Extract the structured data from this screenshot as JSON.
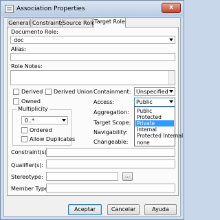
{
  "window": {
    "title": "Association Properties",
    "close_label": "x"
  },
  "tabs": [
    {
      "label": "General"
    },
    {
      "label": "Constraints"
    },
    {
      "label": "Source Role"
    },
    {
      "label": "Target Role"
    }
  ],
  "target_role": {
    "role_label": "Documento Role:",
    "role_value": "doc",
    "alias_label": "Alias:",
    "alias_value": "",
    "role_notes_label": "Role Notes:",
    "derived_label": "Derived",
    "derived_union_label": "Derived Union",
    "owned_label": "Owned",
    "multiplicity_label": "Multiplicity",
    "multiplicity_value": "0..*",
    "ordered_label": "Ordered",
    "allow_duplicates_label": "Allow Duplicates",
    "containment_label": "Containment:",
    "containment_value": "Unspecified",
    "access_label": "Access:",
    "access_value": "Public",
    "aggregation_label": "Aggregation:",
    "target_scope_label": "Target Scope:",
    "navigability_label": "Navigability:",
    "changeable_label": "Changeable:",
    "changeable_value": "none",
    "access_options": [
      "Public",
      "Protected",
      "Private",
      "Internal",
      "Protected Internal"
    ],
    "access_highlighted": "Private"
  },
  "lower_fields": {
    "constraints_label": "Constraint(s):",
    "qualifiers_label": "Qualifier(s):",
    "stereotype_label": "Stereotype:",
    "stereotype_button": "...",
    "member_type_label": "Member Type:"
  },
  "buttons": {
    "ok": "Aceptar",
    "cancel": "Cancelar",
    "help": "Ayuda"
  }
}
